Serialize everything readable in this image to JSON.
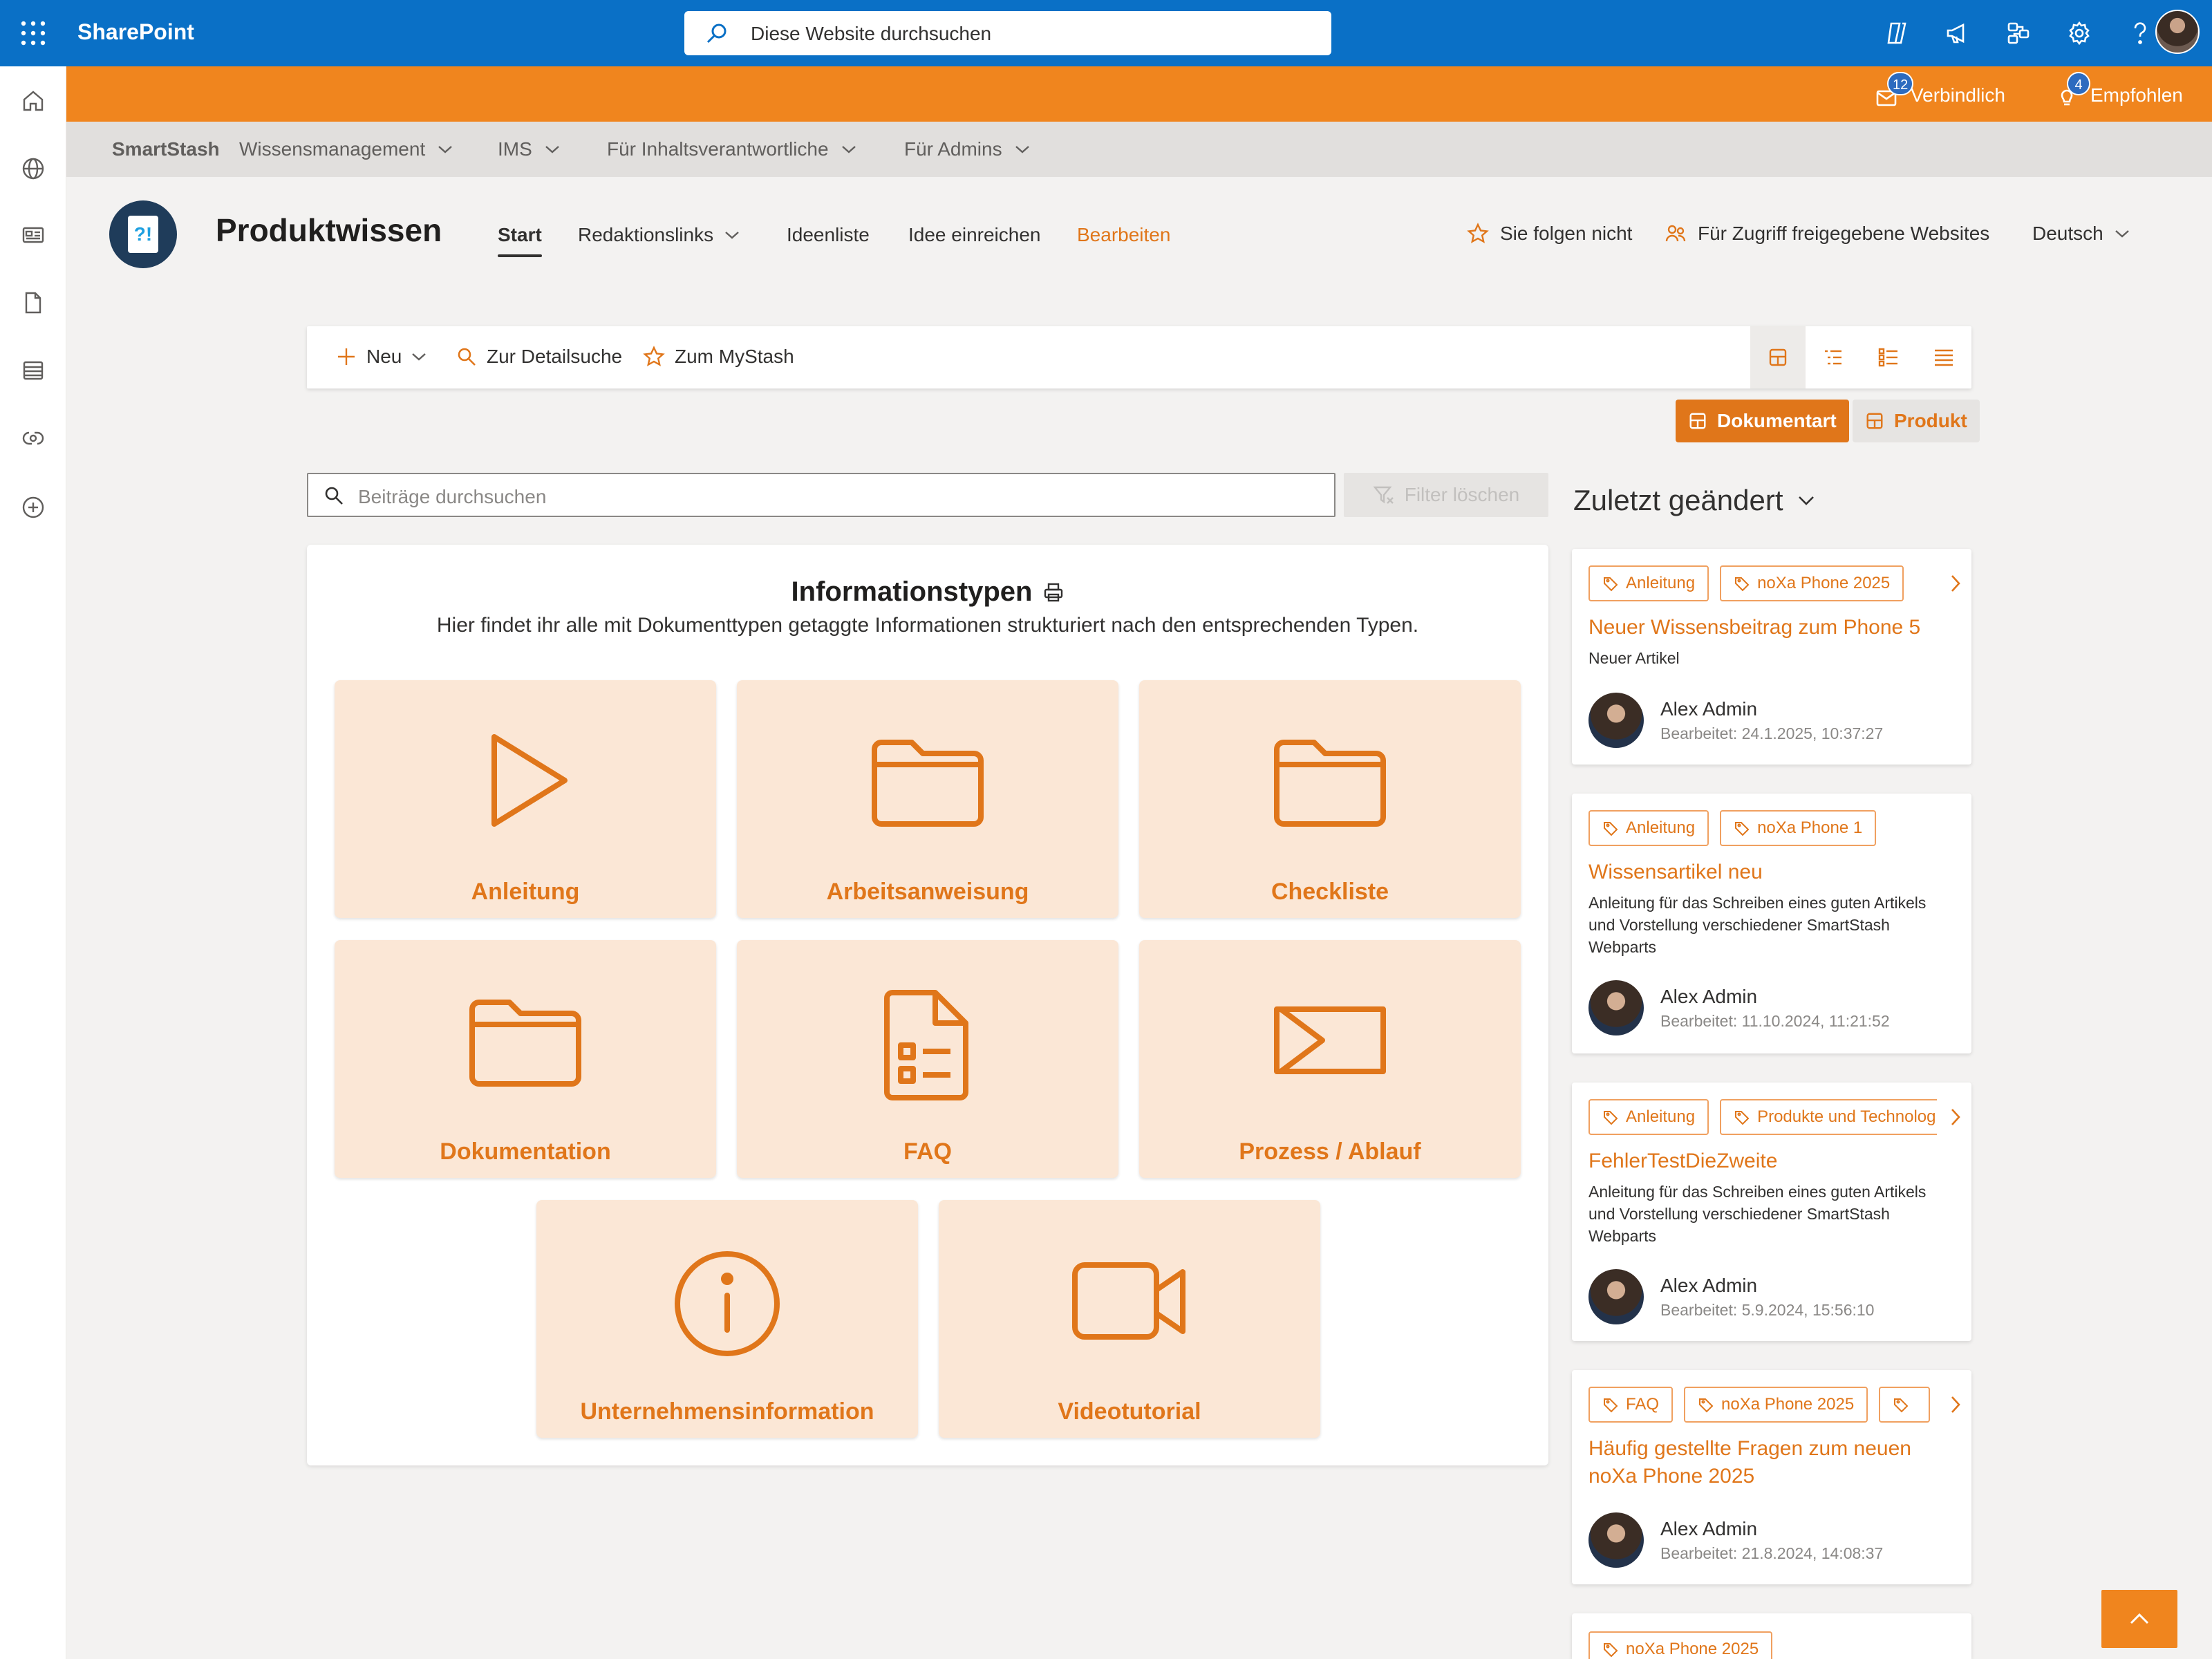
{
  "suitebar": {
    "brand": "SharePoint",
    "search_text": "Diese Website durchsuchen"
  },
  "notifications": {
    "mandatory_count": "12",
    "mandatory_label": "Verbindlich",
    "recommended_count": "4",
    "recommended_label": "Empfohlen"
  },
  "hubnav": {
    "items": [
      {
        "label": "SmartStash"
      },
      {
        "label": "Wissensmanagement"
      },
      {
        "label": "IMS"
      },
      {
        "label": "Für Inhaltsverantwortliche"
      },
      {
        "label": "Für Admins"
      }
    ]
  },
  "site": {
    "logo_text": "?!",
    "title": "Produktwissen",
    "nav": [
      {
        "label": "Start"
      },
      {
        "label": "Redaktionslinks"
      },
      {
        "label": "Ideenliste"
      },
      {
        "label": "Idee einreichen"
      },
      {
        "label": "Bearbeiten"
      }
    ],
    "follow_label": "Sie folgen nicht",
    "shared_label": "Für Zugriff freigegebene Websites",
    "language_label": "Deutsch"
  },
  "cmdbar": {
    "new_label": "Neu",
    "detail_search_label": "Zur Detailsuche",
    "mystash_label": "Zum MyStash"
  },
  "filters": {
    "doctype_label": "Dokumentart",
    "product_label": "Produkt"
  },
  "post_search": {
    "placeholder": "Beiträge durchsuchen",
    "clear_label": "Filter löschen"
  },
  "info_types": {
    "title": "Informationstypen",
    "subtitle": "Hier findet ihr alle mit Dokumenttypen getaggte Informationen strukturiert nach den entsprechenden Typen.",
    "tiles": [
      {
        "label": "Anleitung",
        "icon": "play-icon"
      },
      {
        "label": "Arbeitsanweisung",
        "icon": "folder-icon"
      },
      {
        "label": "Checkliste",
        "icon": "folder-icon"
      },
      {
        "label": "Dokumentation",
        "icon": "folder-icon"
      },
      {
        "label": "FAQ",
        "icon": "document-list-icon"
      },
      {
        "label": "Prozess / Ablauf",
        "icon": "process-icon"
      },
      {
        "label": "Unternehmensinformation",
        "icon": "info-icon"
      },
      {
        "label": "Videotutorial",
        "icon": "video-icon"
      }
    ]
  },
  "recent": {
    "title": "Zuletzt geändert",
    "items": [
      {
        "tags": [
          "Anleitung",
          "noXa Phone 2025"
        ],
        "title": "Neuer Wissensbeitrag zum Phone 5",
        "desc": "Neuer Artikel",
        "author": "Alex Admin",
        "date": "Bearbeitet: 24.1.2025, 10:37:27"
      },
      {
        "tags": [
          "Anleitung",
          "noXa Phone 1"
        ],
        "title": "Wissensartikel neu",
        "desc": "Anleitung für das Schreiben eines guten Artikels und Vorstellung verschiedener SmartStash Webparts",
        "author": "Alex Admin",
        "date": "Bearbeitet: 11.10.2024, 11:21:52"
      },
      {
        "tags": [
          "Anleitung",
          "Produkte und Technologie"
        ],
        "title": "FehlerTestDieZweite",
        "desc": "Anleitung für das Schreiben eines guten Artikels und Vorstellung verschiedener SmartStash Webparts",
        "author": "Alex Admin",
        "date": "Bearbeitet: 5.9.2024, 15:56:10"
      },
      {
        "tags": [
          "FAQ",
          "noXa Phone 2025",
          ""
        ],
        "title": "Häufig gestellte Fragen zum neuen noXa Phone 2025",
        "desc": "",
        "author": "Alex Admin",
        "date": "Bearbeitet: 21.8.2024, 14:08:37"
      },
      {
        "tags": [
          "noXa Phone 2025"
        ],
        "title": "",
        "desc": "",
        "author": "",
        "date": ""
      }
    ]
  },
  "colors": {
    "suitebar": "#0a70c6",
    "accent": "#e0761a",
    "orangebar": "#f0851e",
    "tile_bg": "#fbe7d6"
  }
}
